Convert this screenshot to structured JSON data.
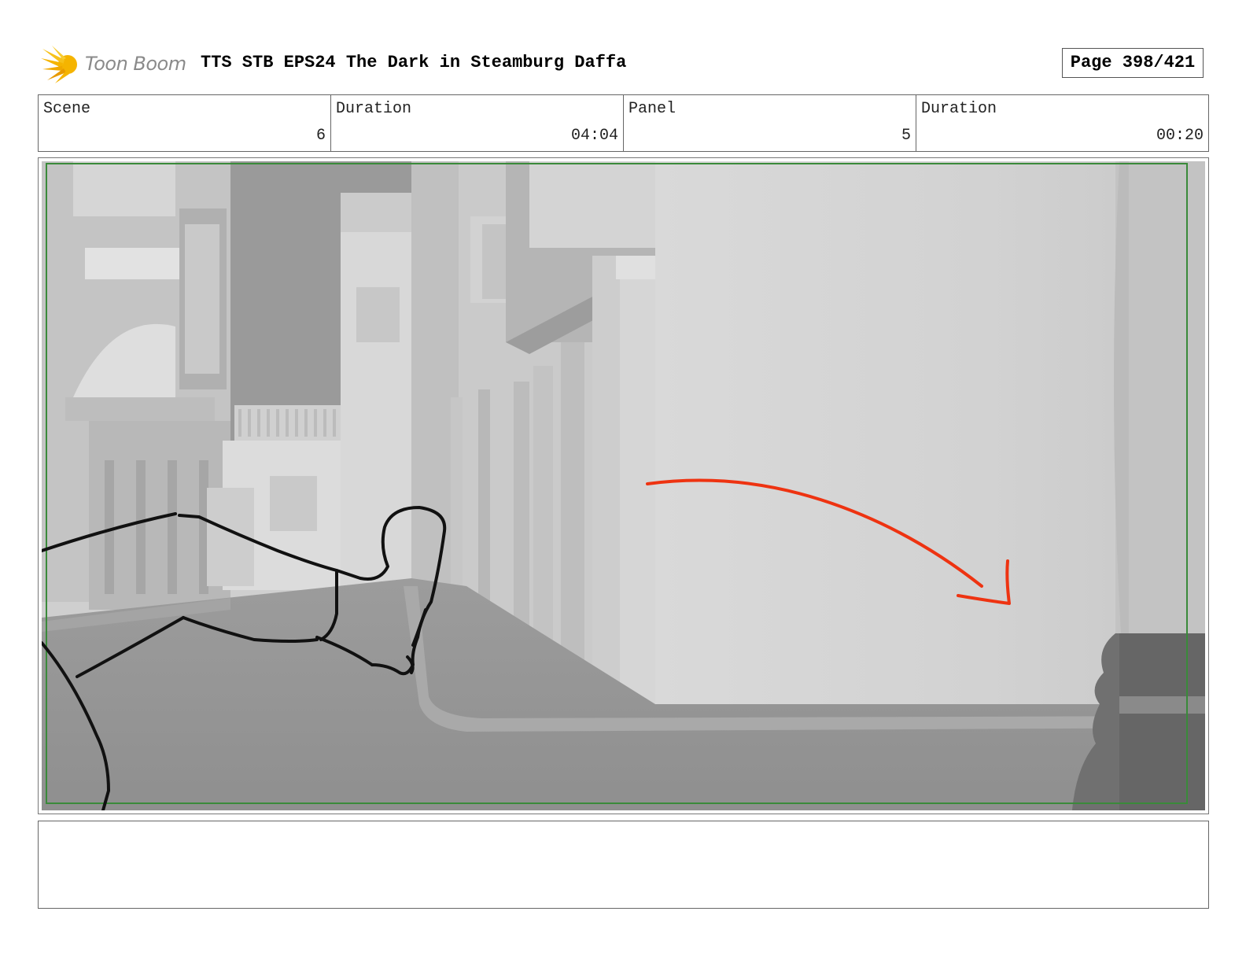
{
  "header": {
    "logo_text": "Toon Boom",
    "title": "TTS STB EPS24 The Dark in Steamburg Daffa",
    "page": "Page 398/421"
  },
  "info": {
    "scene_label": "Scene",
    "scene_value": "6",
    "scene_duration_label": "Duration",
    "scene_duration_value": "04:04",
    "panel_label": "Panel",
    "panel_value": "5",
    "panel_duration_label": "Duration",
    "panel_duration_value": "00:20"
  },
  "colors": {
    "safe_frame": "#3a8a3a",
    "arrow": "#ee3311",
    "sketch": "#111111",
    "logo": "#f5b400"
  },
  "icons": {
    "logo": "toon-boom-sunburst-icon"
  },
  "notes": {
    "text": ""
  }
}
